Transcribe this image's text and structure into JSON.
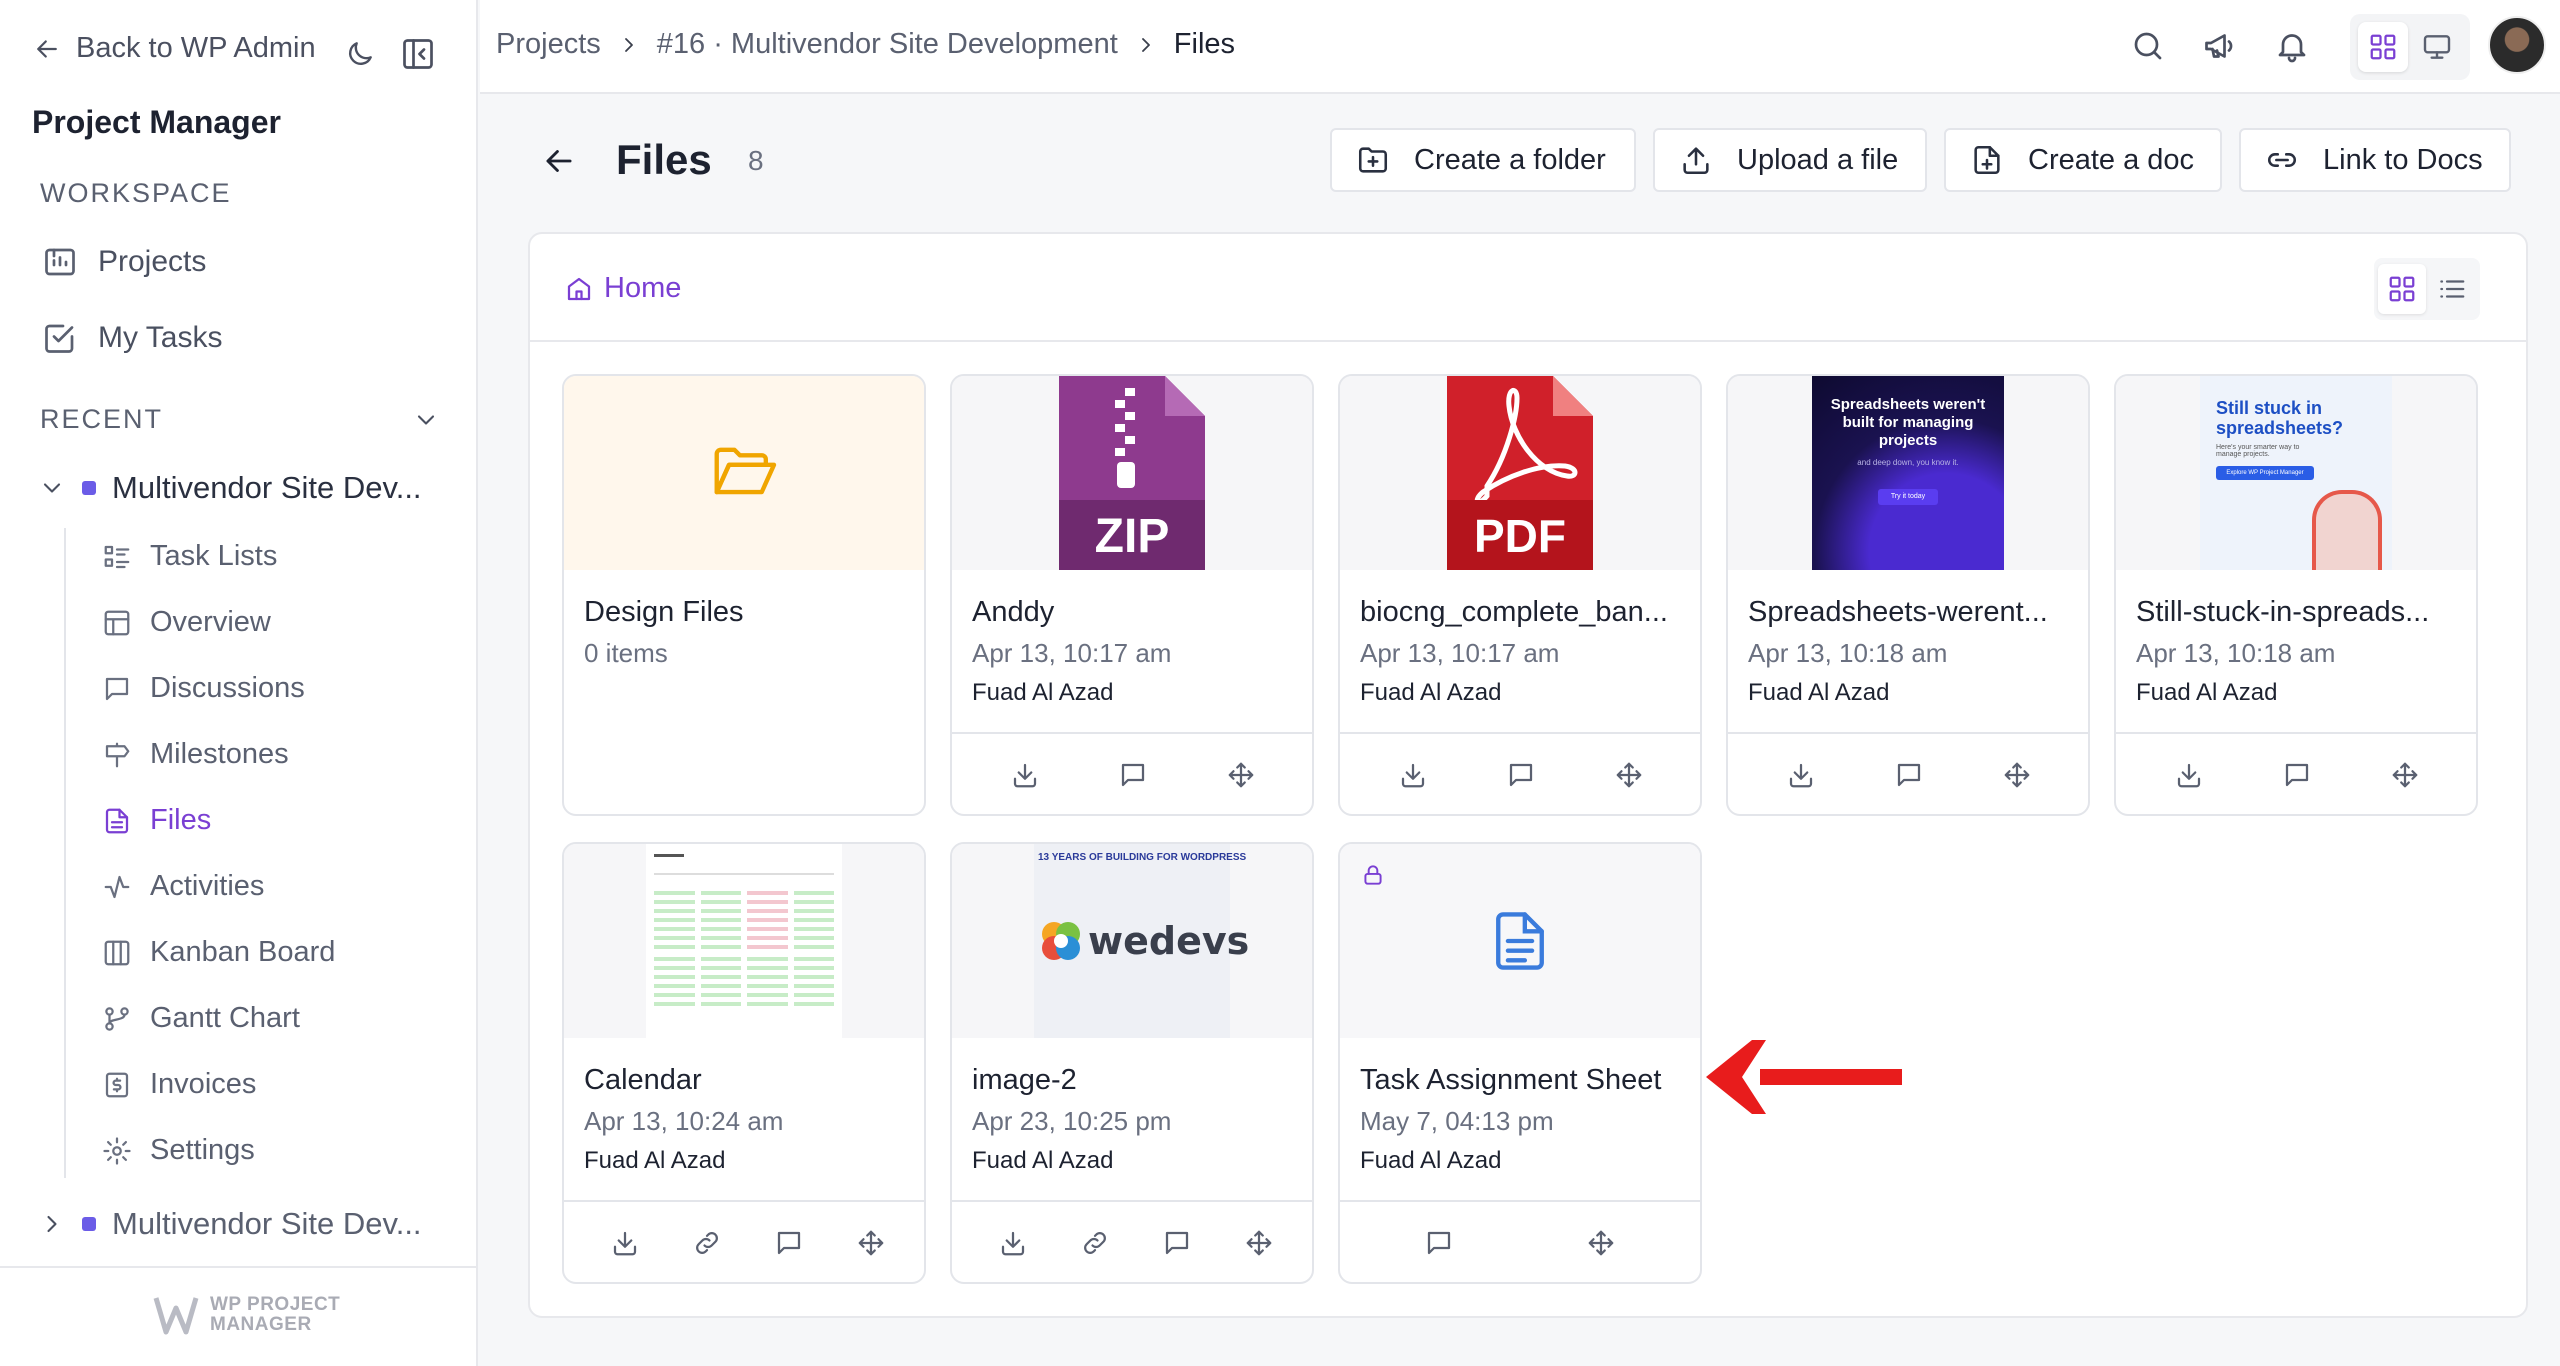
{
  "sidebar": {
    "back_label": "Back to WP Admin",
    "app_title": "Project Manager",
    "workspace_label": "WORKSPACE",
    "workspace_items": [
      {
        "label": "Projects",
        "icon": "projects-icon"
      },
      {
        "label": "My Tasks",
        "icon": "checkbox-icon"
      }
    ],
    "recent_label": "RECENT",
    "project_open": "Multivendor Site Dev...",
    "project_closed": "Multivendor Site Dev...",
    "project_color": "#6b5ce7",
    "sub_items": [
      {
        "label": "Task Lists",
        "icon": "task-list-icon"
      },
      {
        "label": "Overview",
        "icon": "overview-icon"
      },
      {
        "label": "Discussions",
        "icon": "discussion-icon"
      },
      {
        "label": "Milestones",
        "icon": "milestone-icon"
      },
      {
        "label": "Files",
        "icon": "file-icon",
        "active": true
      },
      {
        "label": "Activities",
        "icon": "activity-icon"
      },
      {
        "label": "Kanban Board",
        "icon": "kanban-icon"
      },
      {
        "label": "Gantt Chart",
        "icon": "gantt-icon"
      },
      {
        "label": "Invoices",
        "icon": "invoice-icon"
      },
      {
        "label": "Settings",
        "icon": "settings-icon"
      }
    ],
    "logo_line1": "WP PROJECT",
    "logo_line2": "MANAGER"
  },
  "topbar": {
    "breadcrumbs": [
      "Projects",
      "#16 · Multivendor Site Development",
      "Files"
    ]
  },
  "page": {
    "title": "Files",
    "count": "8",
    "actions": [
      "Create a folder",
      "Upload a file",
      "Create a doc",
      "Link to Docs"
    ]
  },
  "panel": {
    "home_label": "Home"
  },
  "files": [
    {
      "name": "Design Files",
      "date": "0 items",
      "owner": "",
      "type": "folder"
    },
    {
      "name": "Anddy",
      "date": "Apr 13, 10:17 am",
      "owner": "Fuad Al Azad",
      "type": "zip"
    },
    {
      "name": "biocng_complete_ban...",
      "date": "Apr 13, 10:17 am",
      "owner": "Fuad Al Azad",
      "type": "pdf"
    },
    {
      "name": "Spreadsheets-werent...",
      "date": "Apr 13, 10:18 am",
      "owner": "Fuad Al Azad",
      "type": "image-dark",
      "thumb_text": "Spreadsheets weren't built for managing projects",
      "thumb_sub": "and deep down, you know it.",
      "thumb_btn": "Try it today"
    },
    {
      "name": "Still-stuck-in-spreads...",
      "date": "Apr 13, 10:18 am",
      "owner": "Fuad Al Azad",
      "type": "image-light",
      "thumb_text": "Still stuck in spreadsheets?",
      "thumb_sub": "Here's your smarter way to manage projects.",
      "thumb_btn": "Explore WP Project Manager"
    },
    {
      "name": "Calendar",
      "date": "Apr 13, 10:24 am",
      "owner": "Fuad Al Azad",
      "type": "image-calendar"
    },
    {
      "name": "image-2",
      "date": "Apr 23, 10:25 pm",
      "owner": "Fuad Al Azad",
      "type": "image-wedevs",
      "thumb_banner": "13 YEARS OF BUILDING FOR WORDPRESS",
      "thumb_logo": "wedevs"
    },
    {
      "name": "Task Assignment Sheet",
      "date": "May 7, 04:13 pm",
      "owner": "Fuad Al Azad",
      "type": "doc"
    }
  ],
  "colors": {
    "accent": "#7a3fd3",
    "zip": "#8e3a8e",
    "pdf": "#d0202a",
    "folder": "#f0a500",
    "doc": "#3a7bdc",
    "annotation": "#e81c1c"
  }
}
